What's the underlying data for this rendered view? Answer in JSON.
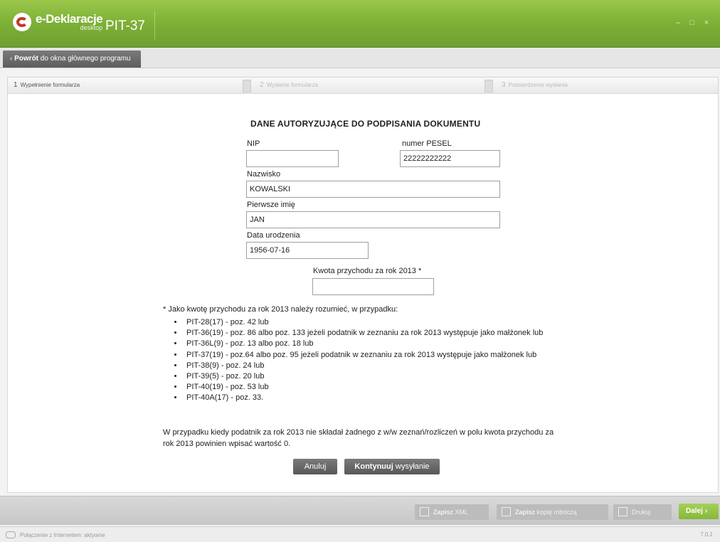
{
  "app": {
    "logo_text": "e-Deklaracje",
    "logo_sub": "desktop",
    "title": "PIT-37"
  },
  "backbar": {
    "label_bold": "Powrót",
    "label_rest": " do okna głównego programu"
  },
  "steps": [
    {
      "num": "1",
      "label": "Wypełnienie formularza"
    },
    {
      "num": "2",
      "label": "Wysłanie formularza"
    },
    {
      "num": "3",
      "label": "Potwierdzenie wysłania"
    }
  ],
  "form": {
    "heading": "DANE AUTORYZUJĄCE DO PODPISANIA DOKUMENTU",
    "nip_label": "NIP",
    "nip_value": "",
    "pesel_label": "numer PESEL",
    "pesel_value": "22222222222",
    "surname_label": "Nazwisko",
    "surname_value": "KOWALSKI",
    "firstname_label": "Pierwsze imię",
    "firstname_value": "JAN",
    "birthdate_label": "Data urodzenia",
    "birthdate_value": "1956-07-16",
    "income_label": "Kwota przychodu za rok 2013 *",
    "income_value": ""
  },
  "note": {
    "intro": "* Jako kwotę przychodu za rok 2013 należy rozumieć, w przypadku:",
    "items": [
      "PIT-28(17) - poz. 42 lub",
      "PIT-36(19) - poz. 86 albo poz. 133 jeżeli podatnik w zeznaniu za rok 2013 występuje jako małżonek lub",
      "PIT-36L(9) - poz. 13 albo poz. 18 lub",
      "PIT-37(19) - poz.64 albo poz. 95 jeżeli podatnik w zeznaniu za rok 2013 występuje jako małżonek lub",
      "PIT-38(9) - poz. 24 lub",
      "PIT-39(5) - poz. 20 lub",
      "PIT-40(19) - poz. 53 lub",
      "PIT-40A(17) - poz. 33."
    ],
    "para": "W przypadku kiedy podatnik za rok 2013 nie składał żadnego z w/w zeznań/rozliczeń w polu kwota przychodu za rok 2013 powinien wpisać wartość 0."
  },
  "buttons": {
    "cancel": "Anuluj",
    "continue_bold": "Kontynuuj",
    "continue_rest": " wysyłanie"
  },
  "toolbar": {
    "save_xml_bold": "Zapisz",
    "save_xml_rest": " XML",
    "save_draft_bold": "Zapisz",
    "save_draft_rest": " kopię roboczą",
    "print": "Drukuj",
    "next": "Dalej"
  },
  "status": {
    "connection": "Połączenie z Internetem: aktywne",
    "version": "7.0.1"
  },
  "colors": {
    "brand_green": "#7fb238",
    "button_dark": "#5f5f5f"
  }
}
